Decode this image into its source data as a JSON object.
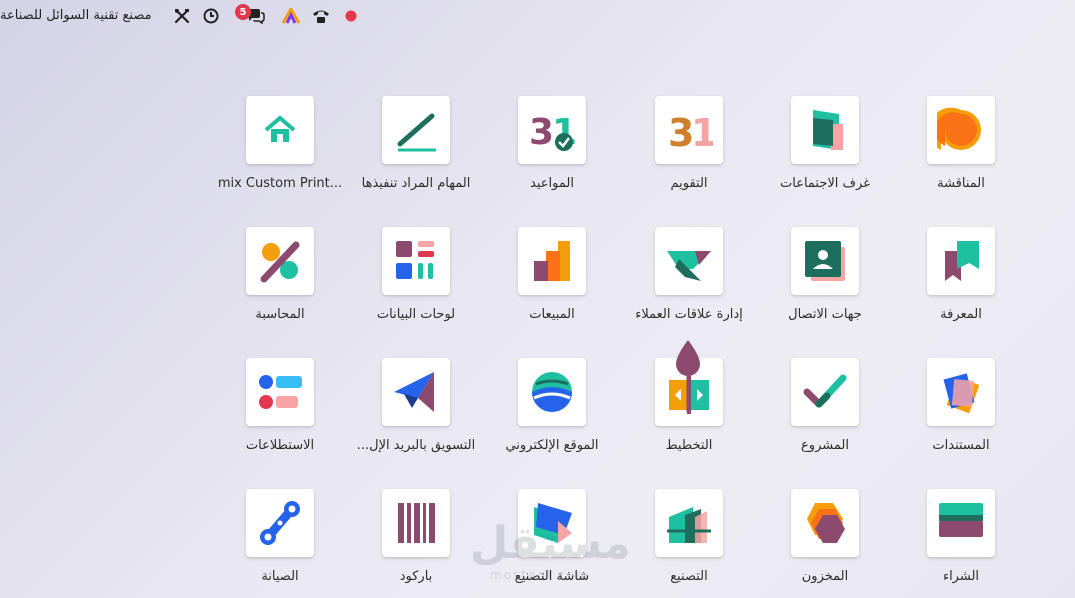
{
  "topbar": {
    "company_name": "مصنع تقنية السوائل للصناعة",
    "chat_badge_count": "5",
    "icons": [
      "tools-icon",
      "clock-icon",
      "chat-icon",
      "brand-logo-icon",
      "phone-icon",
      "status-dot-icon"
    ]
  },
  "apps": [
    {
      "label": "المناقشة",
      "icon": "discuss-icon"
    },
    {
      "label": "غرف الاجتماعات",
      "icon": "meeting-rooms-icon"
    },
    {
      "label": "التقويم",
      "icon": "calendar-icon"
    },
    {
      "label": "المواعيد",
      "icon": "appointments-icon"
    },
    {
      "label": "المهام المراد تنفيذها",
      "icon": "todo-icon"
    },
    {
      "label": "mix Custom Print...",
      "icon": "home-icon"
    },
    {
      "label": "المعرفة",
      "icon": "knowledge-icon"
    },
    {
      "label": "جهات الاتصال",
      "icon": "contacts-icon"
    },
    {
      "label": "إدارة علاقات العملاء",
      "icon": "crm-icon"
    },
    {
      "label": "المبيعات",
      "icon": "sales-icon"
    },
    {
      "label": "لوحات البيانات",
      "icon": "dashboards-icon"
    },
    {
      "label": "المحاسبة",
      "icon": "accounting-icon"
    },
    {
      "label": "المستندات",
      "icon": "documents-icon"
    },
    {
      "label": "المشروع",
      "icon": "project-icon"
    },
    {
      "label": "التخطيط",
      "icon": "planning-icon"
    },
    {
      "label": "الموقع الإلكتروني",
      "icon": "website-icon"
    },
    {
      "label": "التسويق بالبريد الإل...",
      "icon": "email-marketing-icon"
    },
    {
      "label": "الاستطلاعات",
      "icon": "surveys-icon"
    },
    {
      "label": "الشراء",
      "icon": "purchase-icon"
    },
    {
      "label": "المخزون",
      "icon": "inventory-icon"
    },
    {
      "label": "التصنيع",
      "icon": "manufacturing-icon"
    },
    {
      "label": "شاشة التصنيع",
      "icon": "shop-floor-icon"
    },
    {
      "label": "باركود",
      "icon": "barcode-icon"
    },
    {
      "label": "الصيانة",
      "icon": "maintenance-icon"
    }
  ],
  "watermark": {
    "main": "مستقل",
    "sub": "mostaql.com"
  },
  "colors": {
    "badge": "#e2384d",
    "record_dot": "#e2384d",
    "brand_teal": "#1fbfa2",
    "brand_purple": "#714b67"
  }
}
